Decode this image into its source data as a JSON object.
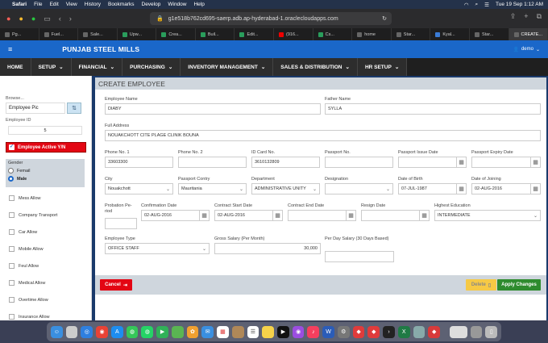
{
  "macbar": {
    "menus": [
      "Safari",
      "File",
      "Edit",
      "View",
      "History",
      "Bookmarks",
      "Develop",
      "Window",
      "Help"
    ],
    "datetime": "Tue 19 Sep  1:12 AM"
  },
  "browser": {
    "url": "g1e518b762cd695-saerp.adb.ap-hyderabad-1.oraclecloudapps.com"
  },
  "tabs": [
    {
      "label": "Pg..."
    },
    {
      "label": "Fuel..."
    },
    {
      "label": "Sale..."
    },
    {
      "label": "Upw..."
    },
    {
      "label": "Crea..."
    },
    {
      "label": "Buil..."
    },
    {
      "label": "Edit..."
    },
    {
      "label": "(916..."
    },
    {
      "label": "Cs..."
    },
    {
      "label": "home"
    },
    {
      "label": "Star..."
    },
    {
      "label": "Kyal..."
    },
    {
      "label": "Star..."
    },
    {
      "label": "CREATE..."
    }
  ],
  "app": {
    "brand": "PUNJAB STEEL MILLS",
    "user": "demo"
  },
  "nav": [
    "HOME",
    "SETUP",
    "FINANCIAL",
    "PURCHASING",
    "INVENTORY MANAGEMENT",
    "SALES & DISTRIBUTION",
    "HR SETUP"
  ],
  "sidebar": {
    "browse_label": "Browse...",
    "pic_value": "Employee Pic",
    "empid_label": "Employee ID",
    "empid_value": "5",
    "active_label": "Employee Active Y/N",
    "gender_label": "Gender",
    "gender_options": [
      "Femail",
      "Male"
    ],
    "allowances": [
      "Mess Allow",
      "Company Transport",
      "Car Allow",
      "Mobile Allow",
      "Feul Allow",
      "Medical Allow",
      "Overtime Allow",
      "Insurance Allow"
    ]
  },
  "form": {
    "title": "CREATE EMPLOYEE",
    "employee_name": {
      "label": "Employee Name",
      "value": "DIABY"
    },
    "father_name": {
      "label": "Father Name",
      "value": "SYLLA"
    },
    "full_address": {
      "label": "Full Address",
      "value": "NOUAKCHOTT CITE PLAGE CLINIK BOUNA"
    },
    "phone1": {
      "label": "Phone No. 1",
      "value": "33603300"
    },
    "phone2": {
      "label": "Phone No. 2",
      "value": ""
    },
    "id_card": {
      "label": "ID Card No.",
      "value": "3610132809"
    },
    "passport_no": {
      "label": "Passport No.",
      "value": ""
    },
    "passport_issue": {
      "label": "Passport Issue Date",
      "value": ""
    },
    "passport_expiry": {
      "label": "Passport Expiry Date",
      "value": ""
    },
    "city": {
      "label": "City",
      "value": "Nouakchott"
    },
    "passport_country": {
      "label": "Passport Contry",
      "value": "Mauritania"
    },
    "department": {
      "label": "Department",
      "value": "ADMINISTRATIVE UNITY"
    },
    "designation": {
      "label": "Designation",
      "value": ""
    },
    "dob": {
      "label": "Date of Birth",
      "value": "07-JUL-1987"
    },
    "doj": {
      "label": "Date of Joining",
      "value": "02-AUG-2016"
    },
    "probation": {
      "label": "Probation Pe-riod",
      "value": ""
    },
    "confirmation": {
      "label": "Confirmation Date",
      "value": "02-AUG-2016"
    },
    "contract_start": {
      "label": "Contract Start Date",
      "value": "02-AUG-2016"
    },
    "contract_end": {
      "label": "Contract End Date",
      "value": ""
    },
    "resign": {
      "label": "Resign Date",
      "value": ""
    },
    "education": {
      "label": "Highest Education",
      "value": "INTERMEDIATE"
    },
    "emp_type": {
      "label": "Employee Type",
      "value": "OFFICE STAFF"
    },
    "gross_salary": {
      "label": "Gross Salary (Per Month)",
      "value": "30,000"
    },
    "per_day": {
      "label": "Per Day Salary (30 Days Based)",
      "value": ""
    }
  },
  "buttons": {
    "cancel": "Cancel",
    "delete": "Delete",
    "apply": "Apply Changes"
  }
}
